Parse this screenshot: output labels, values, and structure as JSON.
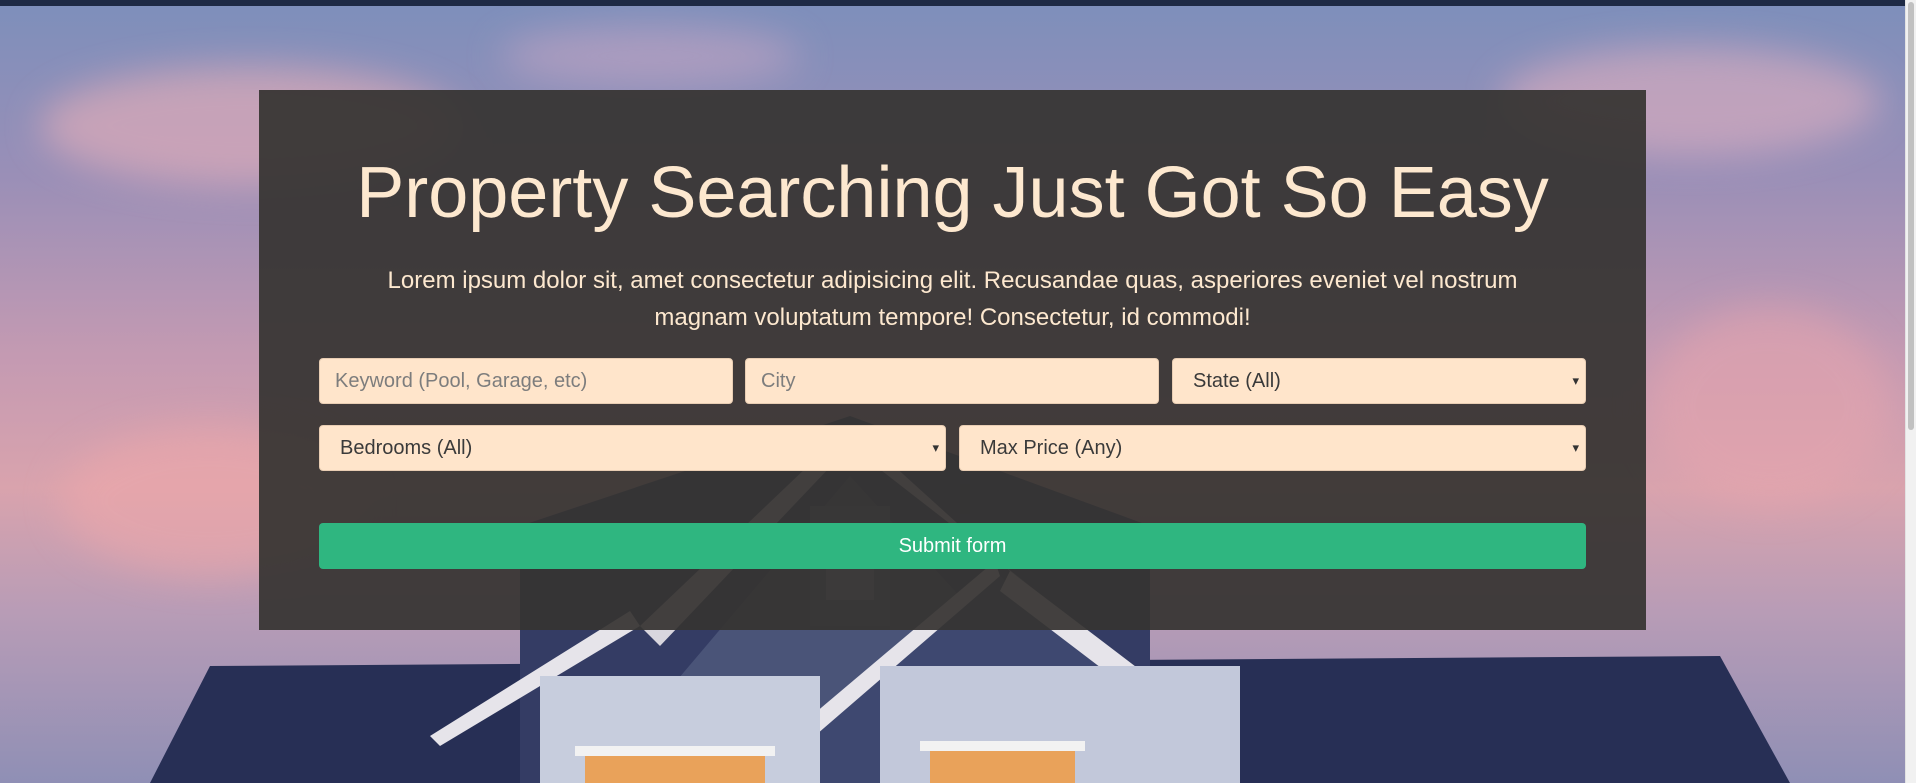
{
  "hero": {
    "title": "Property Searching Just Got So Easy",
    "lead": "Lorem ipsum dolor sit, amet consectetur adipisicing elit. Recusandae quas, asperiores eveniet vel nostrum magnam voluptatum tempore! Consectetur, id commodi!"
  },
  "form": {
    "keyword_placeholder": "Keyword (Pool, Garage, etc)",
    "keyword_value": "",
    "city_placeholder": "City",
    "city_value": "",
    "state_selected": "State (All)",
    "bedrooms_selected": "Bedrooms (All)",
    "max_price_selected": "Max Price (Any)",
    "submit_label": "Submit form"
  },
  "icons": {
    "dropdown_caret": "▾"
  },
  "colors": {
    "accent": "#2fb680",
    "panel": "#363432",
    "heading_text": "#fde8cf",
    "field_background": "#ffe5cb",
    "top_bar": "#1e2a45"
  }
}
